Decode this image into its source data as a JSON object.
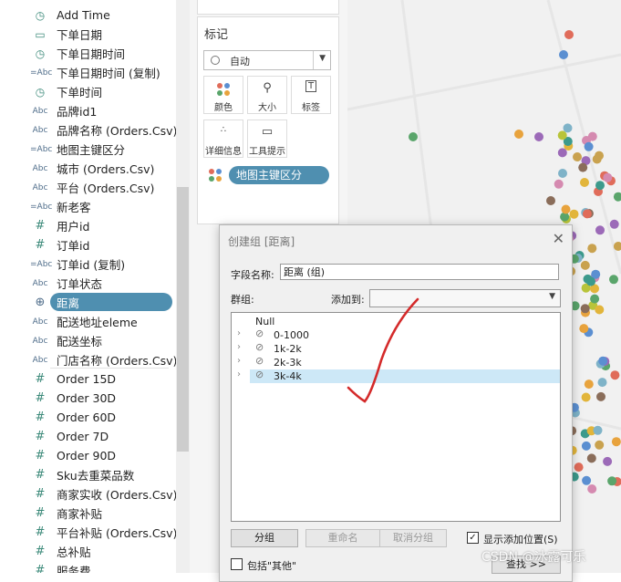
{
  "data_pane": {
    "fields": [
      {
        "type": "date-time",
        "label": "Add Time"
      },
      {
        "type": "date",
        "label": "下单日期"
      },
      {
        "type": "date-time",
        "label": "下单日期时间"
      },
      {
        "type": "=Abc",
        "label": "下单日期时间 (复制)"
      },
      {
        "type": "date-time",
        "label": "下单时间"
      },
      {
        "type": "Abc",
        "label": "品牌id1"
      },
      {
        "type": "Abc",
        "label": "品牌名称 (Orders.Csv)"
      },
      {
        "type": "=Abc",
        "label": "地图主键区分"
      },
      {
        "type": "Abc",
        "label": "城市 (Orders.Csv)"
      },
      {
        "type": "Abc",
        "label": "平台 (Orders.Csv)"
      },
      {
        "type": "=Abc",
        "label": "新老客"
      },
      {
        "type": "#",
        "label": "用户id"
      },
      {
        "type": "#",
        "label": "订单id"
      },
      {
        "type": "=Abc",
        "label": "订单id (复制)"
      },
      {
        "type": "Abc",
        "label": "订单状态"
      },
      {
        "type": "geo",
        "label": "距离"
      },
      {
        "type": "Abc",
        "label": "配送地址eleme"
      },
      {
        "type": "Abc",
        "label": "配送坐标"
      },
      {
        "type": "Abc",
        "label": "门店名称 (Orders.Csv)"
      },
      {
        "type": "#",
        "label": "Order 15D"
      },
      {
        "type": "#",
        "label": "Order 30D"
      },
      {
        "type": "#",
        "label": "Order 60D"
      },
      {
        "type": "#",
        "label": "Order 7D"
      },
      {
        "type": "#",
        "label": "Order 90D"
      },
      {
        "type": "#",
        "label": "Sku去重菜品数"
      },
      {
        "type": "#",
        "label": "商家实收 (Orders.Csv)"
      },
      {
        "type": "#",
        "label": "商家补贴"
      },
      {
        "type": "#",
        "label": "平台补贴 (Orders.Csv)"
      },
      {
        "type": "#",
        "label": "总补贴"
      },
      {
        "type": "#",
        "label": "服务费"
      }
    ],
    "selected_label": "距离",
    "icon_glyphs": {
      "#": "#",
      "geo": "⊕",
      "date": "▭",
      "date-time": "◷"
    }
  },
  "marks": {
    "title": "标记",
    "mark_type": "自动",
    "buttons": [
      "颜色",
      "大小",
      "标签",
      "详细信息",
      "工具提示"
    ],
    "color_pill": "地图主键区分"
  },
  "dialog": {
    "title": "创建组 [距离]",
    "field_name_label": "字段名称:",
    "field_name_value": "距离 (组)",
    "group_label": "群组:",
    "add_to_label": "添加到:",
    "add_to_value": "",
    "tree": [
      {
        "label": "Null",
        "expandable": false,
        "selected": false
      },
      {
        "label": "0-1000",
        "expandable": true,
        "selected": false
      },
      {
        "label": "1k-2k",
        "expandable": true,
        "selected": false
      },
      {
        "label": "2k-3k",
        "expandable": true,
        "selected": false
      },
      {
        "label": "3k-4k",
        "expandable": true,
        "selected": true
      }
    ],
    "buttons": {
      "group": "分组",
      "rename": "重命名",
      "ungroup": "取消分组",
      "find": "查找 >>"
    },
    "show_add_position": {
      "label": "显示添加位置(S)",
      "checked": true
    },
    "include_other": {
      "label": "包括\"其他\"",
      "checked": false
    }
  },
  "colors": {
    "accent_pill": "#4f8fb0",
    "selection": "#cde8f7",
    "checkmark": "#d42a2a",
    "map_background": "#f1f1f1"
  },
  "watermark": "CSDN @冰露可乐"
}
